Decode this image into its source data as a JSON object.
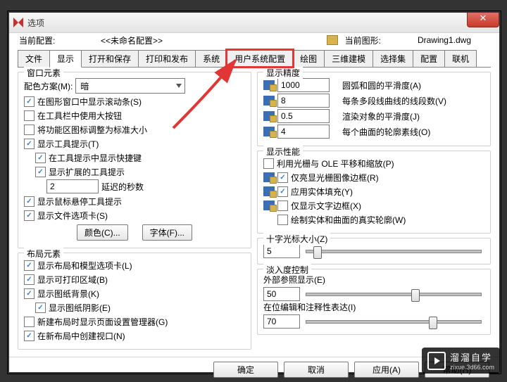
{
  "title": "选项",
  "info": {
    "cur_profile_label": "当前配置:",
    "profile_name": "<<未命名配置>>",
    "cur_drawing_label": "当前图形:",
    "drawing": "Drawing1.dwg"
  },
  "tabs": [
    "文件",
    "显示",
    "打开和保存",
    "打印和发布",
    "系统",
    "用户系统配置",
    "绘图",
    "三维建模",
    "选择集",
    "配置",
    "联机"
  ],
  "active_tab": 1,
  "highlight_tab": 5,
  "left": {
    "g1": {
      "title": "窗口元素",
      "scheme_label": "配色方案(M):",
      "scheme_value": "暗",
      "cb1": "在图形窗口中显示滚动条(S)",
      "cb2": "在工具栏中使用大按钮",
      "cb3": "将功能区图标调整为标准大小",
      "cb4": "显示工具提示(T)",
      "cb4a": "在工具提示中显示快捷键",
      "cb4b": "显示扩展的工具提示",
      "delay_val": "2",
      "delay_lbl": "延迟的秒数",
      "cb5": "显示鼠标悬停工具提示",
      "cb6": "显示文件选项卡(S)",
      "btn_color": "颜色(C)...",
      "btn_font": "字体(F)..."
    },
    "g2": {
      "title": "布局元素",
      "cb1": "显示布局和模型选项卡(L)",
      "cb2": "显示可打印区域(B)",
      "cb3": "显示图纸背景(K)",
      "cb3a": "显示图纸阴影(E)",
      "cb4": "新建布局时显示页面设置管理器(G)",
      "cb5": "在新布局中创建视口(N)"
    }
  },
  "right": {
    "g1": {
      "title": "显示精度",
      "r1v": "1000",
      "r1l": "圆弧和圆的平滑度(A)",
      "r2v": "8",
      "r2l": "每条多段线曲线的线段数(V)",
      "r3v": "0.5",
      "r3l": "渲染对象的平滑度(J)",
      "r4v": "4",
      "r4l": "每个曲面的轮廓素线(O)"
    },
    "g2": {
      "title": "显示性能",
      "cb1": "利用光栅与 OLE 平移和缩放(P)",
      "cb2": "仅亮显光栅图像边框(R)",
      "cb3": "应用实体填充(Y)",
      "cb4": "仅显示文字边框(X)",
      "cb5": "绘制实体和曲面的真实轮廓(W)"
    },
    "g3": {
      "title": "十字光标大小(Z)",
      "val": "5"
    },
    "g4": {
      "title": "淡入度控制",
      "l1": "外部参照显示(E)",
      "v1": "50",
      "l2": "在位编辑和注释性表达(I)",
      "v2": "70"
    }
  },
  "footer": {
    "ok": "确定",
    "cancel": "取消",
    "apply": "应用(A)",
    "help": "帮助(H)"
  },
  "watermark": {
    "brand": "溜溜自学",
    "url": "zixue.3d66.com"
  }
}
